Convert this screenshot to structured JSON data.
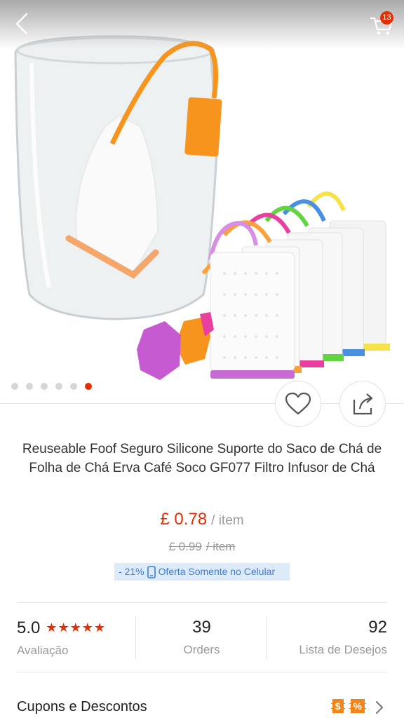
{
  "header": {
    "back_icon": "chevron-left-icon",
    "cart_icon": "cart-icon",
    "cart_count": "13"
  },
  "gallery": {
    "dot_count": 6,
    "active_index": 5
  },
  "actions": {
    "wishlist_icon": "heart-outline-icon",
    "share_icon": "share-icon"
  },
  "product": {
    "title": "Reuseable Foof Seguro Silicone Suporte do Saco de Chá de Folha de Chá Erva Café Soco GF077 Filtro Infusor de Chá",
    "price": "£ 0.78",
    "price_unit": "/ item",
    "original_price": "£ 0.99",
    "original_unit": "/ item",
    "discount": "- 21%",
    "mobile_offer": "Oferta Somente no Celular"
  },
  "stats": {
    "rating_value": "5.0",
    "rating_label": "Avaliação",
    "stars": "★★★★★",
    "orders_value": "39",
    "orders_label": "Orders",
    "wishlist_value": "92",
    "wishlist_label": "Lista de Desejos"
  },
  "coupons": {
    "label": "Cupons e Descontos",
    "badge1": "$",
    "badge2": "%"
  },
  "colors": {
    "accent": "#e62e04",
    "promo_text": "#3a7fd1",
    "promo_bg": "#ddeaf9",
    "coupon_orange": "#f18519"
  }
}
